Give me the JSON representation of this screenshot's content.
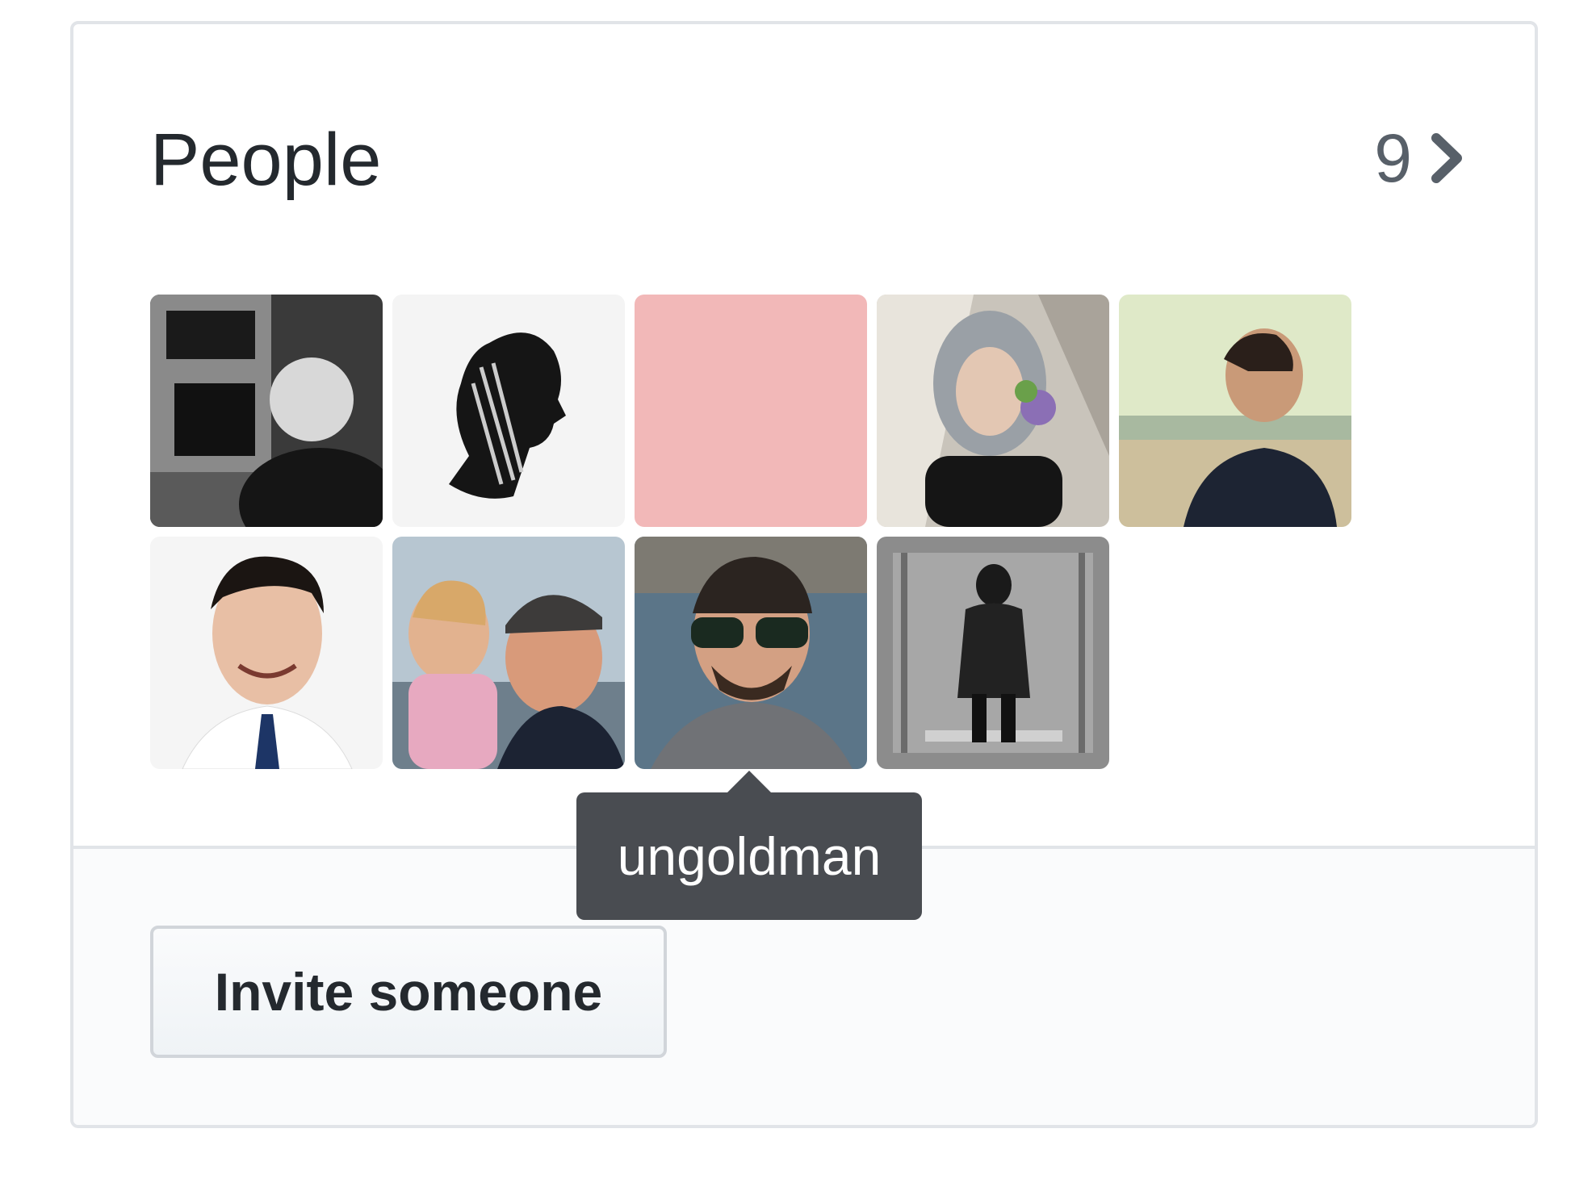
{
  "people": {
    "title": "People",
    "count": "9",
    "chevron_icon": "chevron-right-icon"
  },
  "avatars": [
    {
      "name": "avatar-1",
      "bg": "#2b2b2b"
    },
    {
      "name": "avatar-2",
      "bg": "#f4f4f4"
    },
    {
      "name": "avatar-3",
      "bg": "#f2b8b8"
    },
    {
      "name": "avatar-4",
      "bg": "#b5b0a8"
    },
    {
      "name": "avatar-5",
      "bg": "#d9e6c4"
    },
    {
      "name": "avatar-6",
      "bg": "#f5f5f5"
    },
    {
      "name": "avatar-7",
      "bg": "#9db2c3"
    },
    {
      "name": "avatar-8",
      "bg": "#4f6b7f"
    },
    {
      "name": "avatar-9",
      "bg": "#7a7a7a"
    }
  ],
  "tooltip": {
    "text": "ungoldman"
  },
  "footer": {
    "invite_label": "Invite someone"
  },
  "colors": {
    "border": "#e1e4e8",
    "text": "#24292e",
    "muted": "#586069",
    "tooltip_bg": "#494c51",
    "footer_bg": "#fafbfc"
  }
}
